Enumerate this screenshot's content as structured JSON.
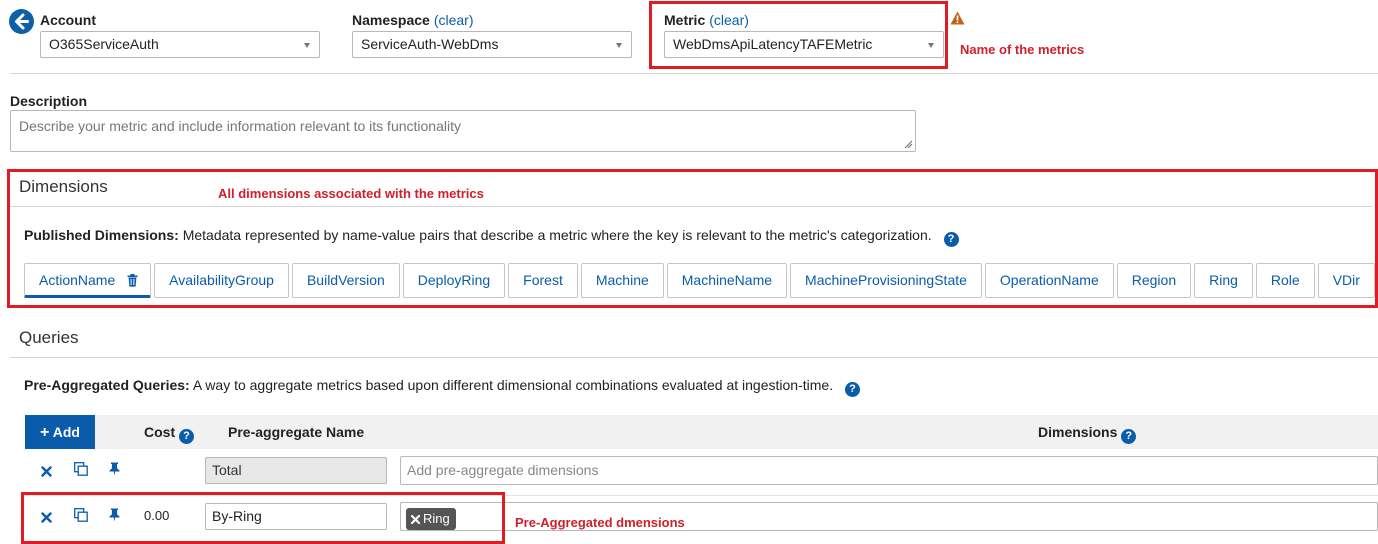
{
  "header": {
    "account": {
      "label": "Account",
      "value": "O365ServiceAuth"
    },
    "namespace": {
      "label": "Namespace",
      "clear": "(clear)",
      "value": "ServiceAuth-WebDms"
    },
    "metric": {
      "label": "Metric",
      "clear": "(clear)",
      "value": "WebDmsApiLatencyTAFEMetric"
    },
    "annotation": "Name of the metrics"
  },
  "description": {
    "label": "Description",
    "placeholder": "Describe your metric and include information relevant to its functionality"
  },
  "dimensions": {
    "title": "Dimensions",
    "annotation": "All dimensions associated with the metrics",
    "published_label": "Published Dimensions:",
    "published_text": "Metadata represented by name-value pairs that describe a metric where the key is relevant to the metric's categorization.",
    "items": [
      "ActionName",
      "AvailabilityGroup",
      "BuildVersion",
      "DeployRing",
      "Forest",
      "Machine",
      "MachineName",
      "MachineProvisioningState",
      "OperationName",
      "Region",
      "Ring",
      "Role",
      "VDir"
    ]
  },
  "queries": {
    "title": "Queries",
    "pre_label": "Pre-Aggregated Queries:",
    "pre_text": "A way to aggregate metrics based upon different dimensional combinations evaluated at ingestion-time.",
    "add_label": "Add",
    "columns": {
      "cost": "Cost",
      "name": "Pre-aggregate Name",
      "dimensions": "Dimensions"
    },
    "rows": [
      {
        "cost": "",
        "name": "Total",
        "dimensions_placeholder": "Add pre-aggregate dimensions",
        "chips": []
      },
      {
        "cost": "0.00",
        "name": "By-Ring",
        "dimensions_placeholder": "",
        "chips": [
          "Ring"
        ]
      }
    ],
    "annotation": "Pre-Aggregated dmensions"
  },
  "colors": {
    "accent": "#0a5cab",
    "annotation_red": "#e01b24"
  }
}
